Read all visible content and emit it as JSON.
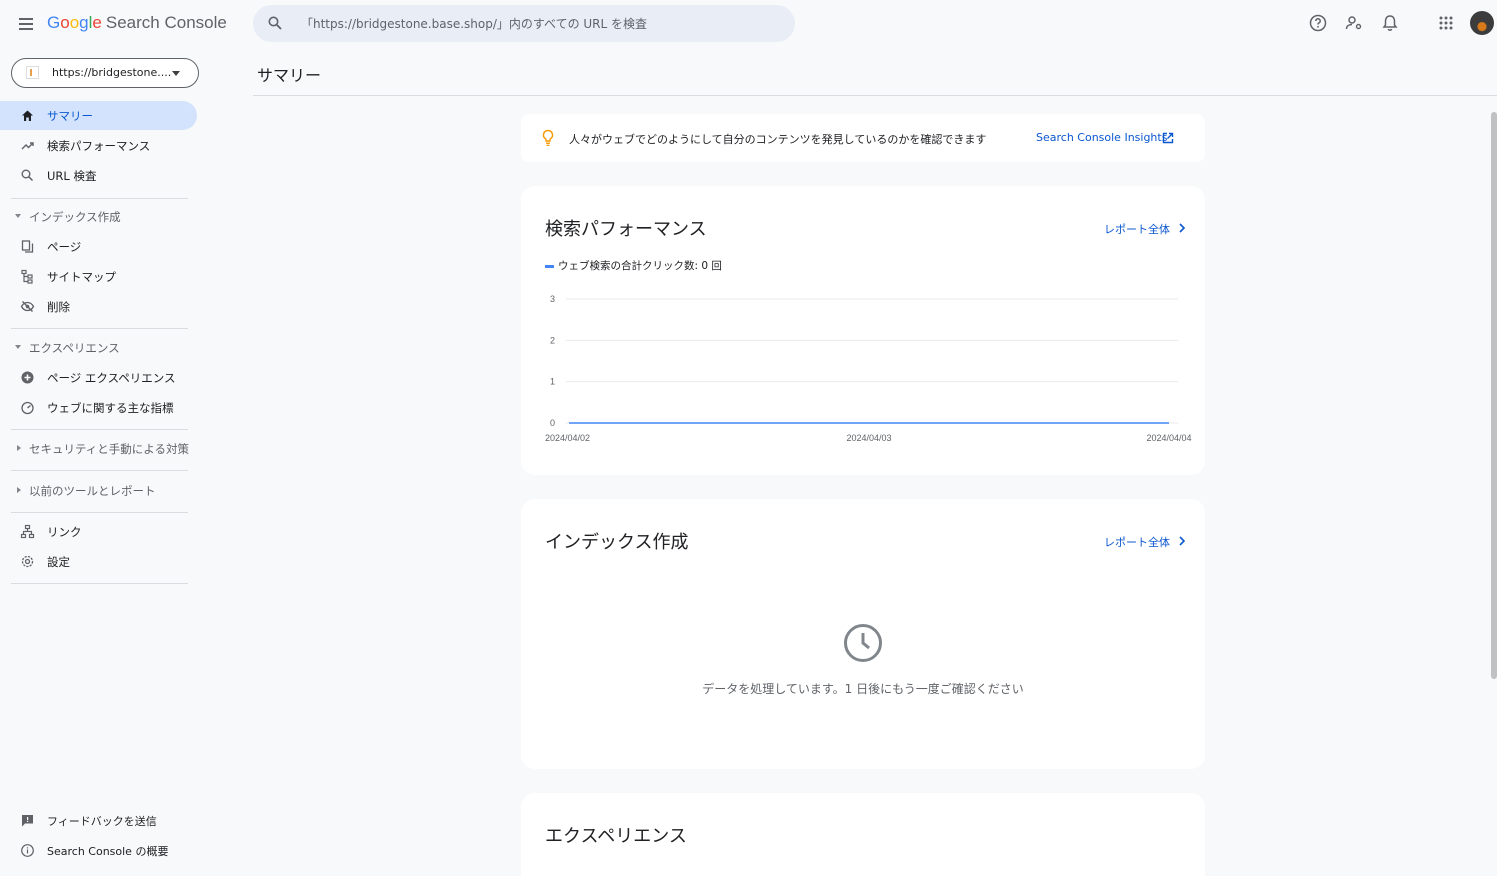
{
  "header": {
    "logo_google": [
      "G",
      "o",
      "o",
      "g",
      "l",
      "e"
    ],
    "logo_product": "Search Console",
    "search_placeholder": "「https://bridgestone.base.shop/」内のすべての URL を検査"
  },
  "sidebar": {
    "property": "https://bridgestone....",
    "items": [
      {
        "label": "サマリー",
        "icon": "home-icon",
        "active": true
      },
      {
        "label": "検索パフォーマンス",
        "icon": "trending-up-icon"
      },
      {
        "label": "URL 検査",
        "icon": "search-icon"
      }
    ],
    "sections": {
      "indexing": {
        "label": "インデックス作成",
        "items": [
          {
            "label": "ページ",
            "icon": "pages-icon"
          },
          {
            "label": "サイトマップ",
            "icon": "sitemap-icon"
          },
          {
            "label": "削除",
            "icon": "eye-off-icon"
          }
        ]
      },
      "experience": {
        "label": "エクスペリエンス",
        "items": [
          {
            "label": "ページ エクスペリエンス",
            "icon": "plus-circle-icon"
          },
          {
            "label": "ウェブに関する主な指標",
            "icon": "speed-icon"
          }
        ]
      },
      "security": {
        "label": "セキュリティと手動による対策"
      },
      "legacy": {
        "label": "以前のツールとレポート"
      }
    },
    "bottom_items": [
      {
        "label": "リンク",
        "icon": "links-icon"
      },
      {
        "label": "設定",
        "icon": "gear-icon"
      }
    ],
    "footer": [
      {
        "label": "フィードバックを送信",
        "icon": "feedback-icon"
      },
      {
        "label": "Search Console の概要",
        "icon": "info-icon"
      }
    ]
  },
  "main": {
    "page_title": "サマリー",
    "insights": {
      "text": "人々がウェブでどのようにして自分のコンテンツを発見しているのかを確認できます",
      "link": "Search Console Insights"
    },
    "performance": {
      "title": "検索パフォーマンス",
      "report_link": "レポート全体",
      "legend": "ウェブ検索の合計クリック数: 0 回"
    },
    "indexing": {
      "title": "インデックス作成",
      "report_link": "レポート全体",
      "message": "データを処理しています。1 日後にもう一度ご確認ください"
    },
    "experience": {
      "title": "エクスペリエンス"
    }
  },
  "colors": {
    "accent": "#0b57d0",
    "line": "#4285f4",
    "active_bg": "#d3e3fd"
  },
  "chart_data": {
    "type": "line",
    "x": [
      "2024/04/02",
      "2024/04/03",
      "2024/04/04"
    ],
    "series": [
      {
        "values": [
          0,
          0,
          0
        ]
      }
    ],
    "yticks": [
      0,
      1,
      2,
      3
    ],
    "ylim": [
      0,
      3
    ],
    "grid": true
  }
}
